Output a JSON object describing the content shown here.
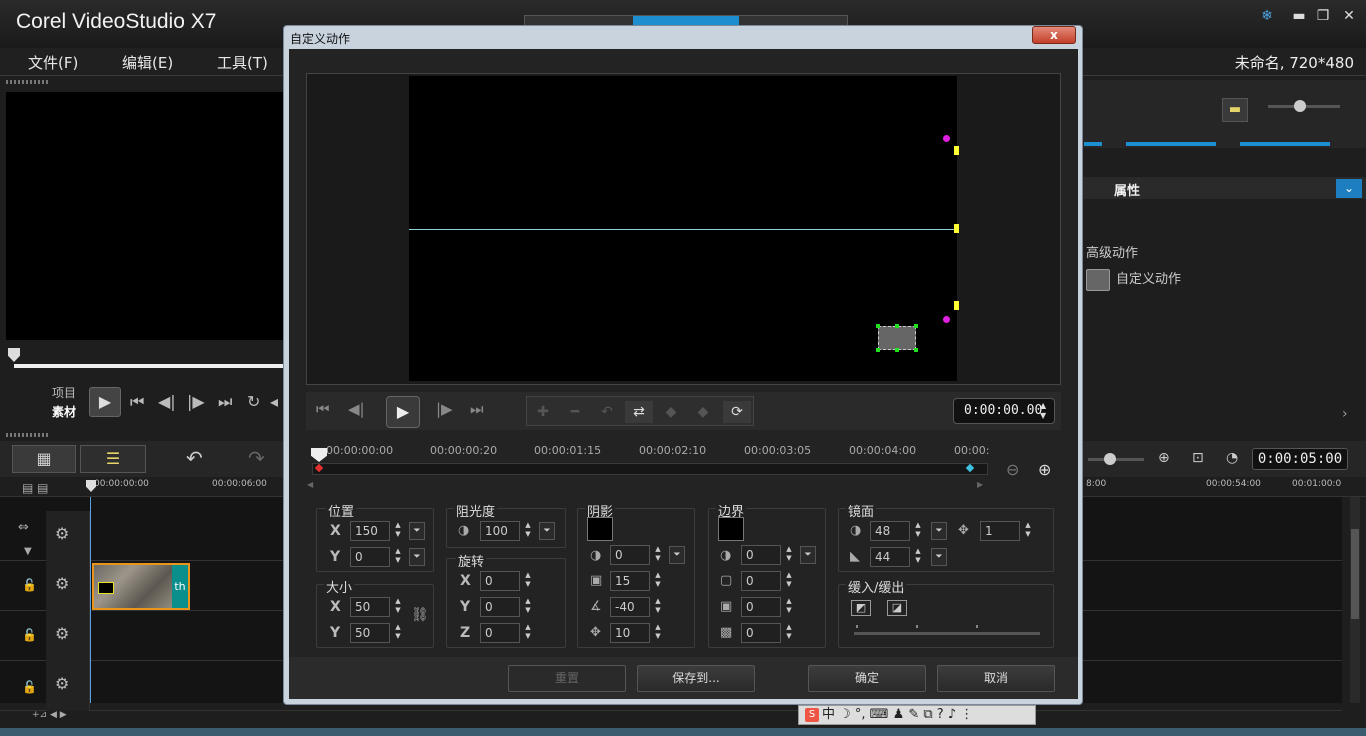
{
  "app": {
    "title": "Corel VideoStudio X7",
    "window_controls": [
      "❄",
      "▬",
      "❐",
      "✕"
    ],
    "menu": [
      "文件(F)",
      "编辑(E)",
      "工具(T)"
    ],
    "project_info": "未命名, 720*480",
    "player": {
      "project_label": "项目",
      "clip_label": "素材"
    },
    "timeline": {
      "ruler_labels": [
        "00:00:00:00",
        "00:00:06:00",
        "8:00",
        "00:00:54:00",
        "00:01:00:0"
      ],
      "timecode": "0:00:05:00",
      "clip_tag": "th"
    },
    "right_panel": {
      "attributes_title": "属性",
      "advanced_motion": "高级动作",
      "custom_motion_item": "自定义动作"
    },
    "ime_bar": "中 ☽ °, ⌨ ♟ ✎ ⧉ ? ♪ ⋮"
  },
  "dialog": {
    "title": "自定义动作",
    "close_label": "x",
    "timecode": "0:00:00.00",
    "ruler_ticks": [
      "00:00:00:00",
      "00:00:00:20",
      "00:00:01:15",
      "00:00:02:10",
      "00:00:03:05",
      "00:00:04:00",
      "00:00:"
    ],
    "position": {
      "label": "位置",
      "x": "150",
      "y": "0"
    },
    "size": {
      "label": "大小",
      "x": "50",
      "y": "50"
    },
    "opacity": {
      "label": "阻光度",
      "value": "100"
    },
    "rotation": {
      "label": "旋转",
      "x": "0",
      "y": "0",
      "z": "0"
    },
    "shadow": {
      "label": "阴影",
      "opacity": "0",
      "blur": "15",
      "angle": "-40",
      "distance": "10"
    },
    "border": {
      "label": "边界",
      "opacity": "0",
      "width": "0",
      "blur": "0",
      "other": "0"
    },
    "mirror": {
      "label": "镜面",
      "opacity": "48",
      "distance": "1",
      "fade": "44"
    },
    "ease": {
      "label": "缓入/缓出"
    },
    "axis": {
      "x": "X",
      "y": "Y",
      "z": "Z"
    },
    "buttons": {
      "reset": "重置",
      "save_to": "保存到...",
      "ok": "确定",
      "cancel": "取消"
    }
  },
  "colors": {
    "accent": "#1d8fd0",
    "path_line": "#8fd0d8",
    "keyframe_start": "#e03030",
    "keyframe_end": "#3fc0e0",
    "clip_border": "#e8951c"
  }
}
